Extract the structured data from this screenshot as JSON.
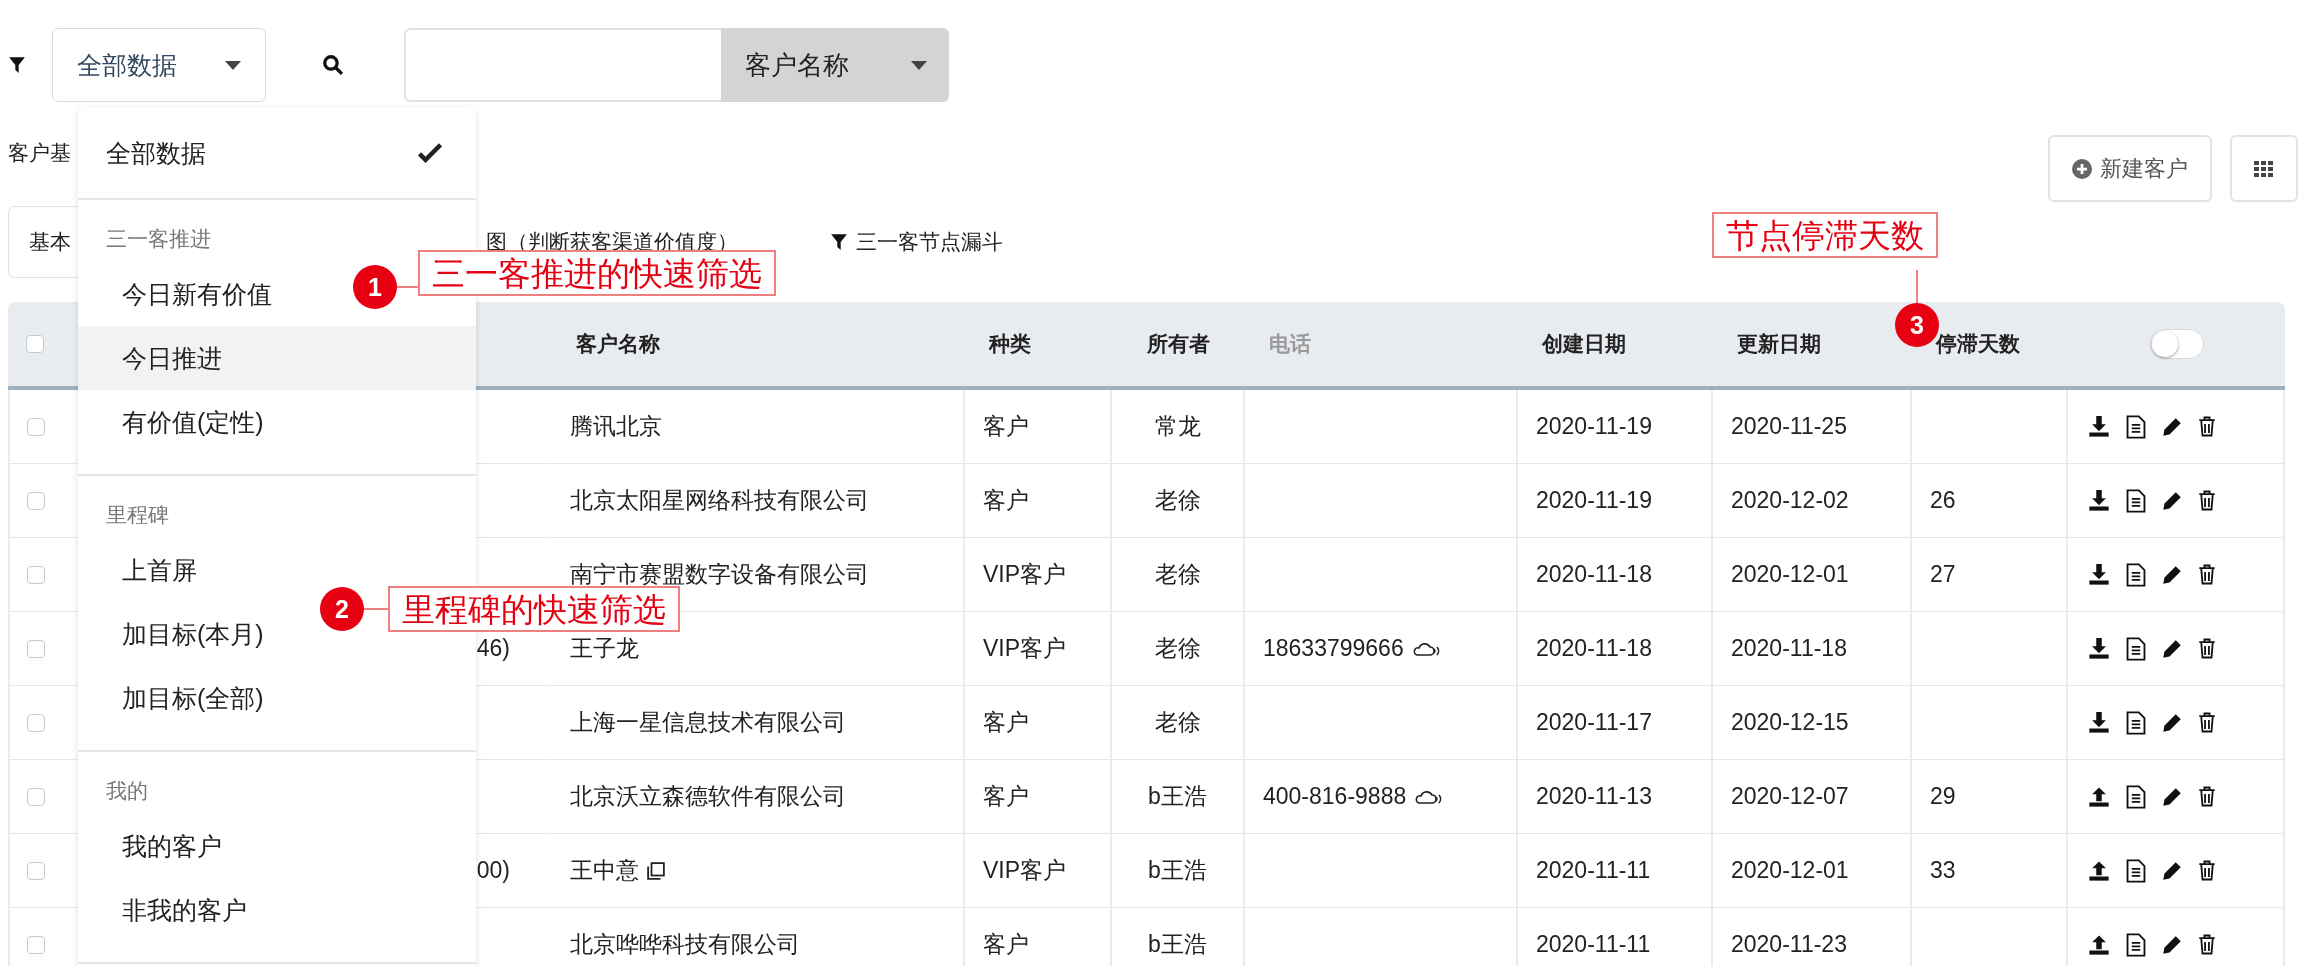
{
  "toolbar": {
    "scope_select": {
      "value": "全部数据"
    },
    "search_field": {
      "field_select": "客户名称"
    }
  },
  "page_label": "客户基",
  "buttons": {
    "new": "新建客户"
  },
  "tabs": [
    {
      "label": "基本",
      "selected": true,
      "kind": "plain"
    },
    {
      "label": "图（判断获客渠道价值度）",
      "selected": false,
      "kind": "plain"
    },
    {
      "label": "三一客节点漏斗",
      "selected": false,
      "kind": "filter"
    }
  ],
  "table": {
    "header_checkbox": {
      "checked": false
    },
    "columns": [
      {
        "label": "客户名称",
        "muted": false
      },
      {
        "label": "种类",
        "muted": false
      },
      {
        "label": "所有者",
        "muted": false
      },
      {
        "label": "电话",
        "muted": true
      },
      {
        "label": "创建日期",
        "muted": false
      },
      {
        "label": "更新日期",
        "muted": false
      },
      {
        "label": "停滞天数",
        "muted": false
      }
    ],
    "toggle": {
      "on": false
    },
    "rows": [
      {
        "checked": false,
        "name": "腾讯北京",
        "type": "客户",
        "owner": "常龙",
        "created": "2020-11-19",
        "updated": "2020-11-25",
        "kind": "download"
      },
      {
        "checked": false,
        "name": "北京太阳星网络科技有限公司",
        "type": "客户",
        "owner": "老徐",
        "created": "2020-11-19",
        "updated": "2020-12-02",
        "stalled_days": "26",
        "kind": "download"
      },
      {
        "checked": false,
        "name": "南宁市赛盟数字设备有限公司",
        "type": "VIP客户",
        "owner": "老徐",
        "created": "2020-11-18",
        "updated": "2020-12-01",
        "stalled_days": "27",
        "kind": "download"
      },
      {
        "checked": false,
        "column_2": "46)",
        "name": "王子龙",
        "type": "VIP客户",
        "owner": "老徐",
        "phone": "18633799666",
        "call_icon": true,
        "created": "2020-11-18",
        "updated": "2020-11-18",
        "kind": "download"
      },
      {
        "checked": false,
        "name": "上海一星信息技术有限公司",
        "type": "客户",
        "owner": "老徐",
        "created": "2020-11-17",
        "updated": "2020-12-15",
        "kind": "download"
      },
      {
        "checked": false,
        "name": "北京沃立森德软件有限公司",
        "type": "客户",
        "owner": "b王浩",
        "phone": "400-816-9888",
        "call_icon": true,
        "created": "2020-11-13",
        "updated": "2020-12-07",
        "stalled_days": "29",
        "kind": "upload"
      },
      {
        "checked": false,
        "column_2": "00)",
        "name": "王中意",
        "copy_icon": true,
        "type": "VIP客户",
        "owner": "b王浩",
        "created": "2020-11-11",
        "updated": "2020-12-01",
        "stalled_days": "33",
        "kind": "upload"
      },
      {
        "checked": false,
        "name": "北京哗哗科技有限公司",
        "type": "客户",
        "owner": "b王浩",
        "created": "2020-11-11",
        "updated": "2020-11-23",
        "kind": "upload"
      }
    ]
  },
  "dropdown": {
    "top_item": {
      "label": "全部数据",
      "checked": true
    },
    "sections": [
      {
        "header": "三一客推进",
        "items": [
          {
            "label": "今日新有价值",
            "highlighted": false
          },
          {
            "label": "今日推进",
            "highlighted": true
          },
          {
            "label": "有价值(定性)",
            "highlighted": false
          }
        ]
      },
      {
        "header": "里程碑",
        "items": [
          {
            "label": "上首屏",
            "highlighted": false
          },
          {
            "label": "加目标(本月)",
            "highlighted": false
          },
          {
            "label": "加目标(全部)",
            "highlighted": false
          }
        ]
      },
      {
        "header": "我的",
        "items": [
          {
            "label": "我的客户",
            "highlighted": false
          },
          {
            "label": "非我的客户",
            "highlighted": false
          }
        ]
      }
    ]
  },
  "annotations": [
    {
      "number": "1",
      "label": "三一客推进的快速筛选"
    },
    {
      "number": "2",
      "label": "里程碑的快速筛选"
    },
    {
      "number": "3",
      "label": "节点停滞天数"
    }
  ]
}
